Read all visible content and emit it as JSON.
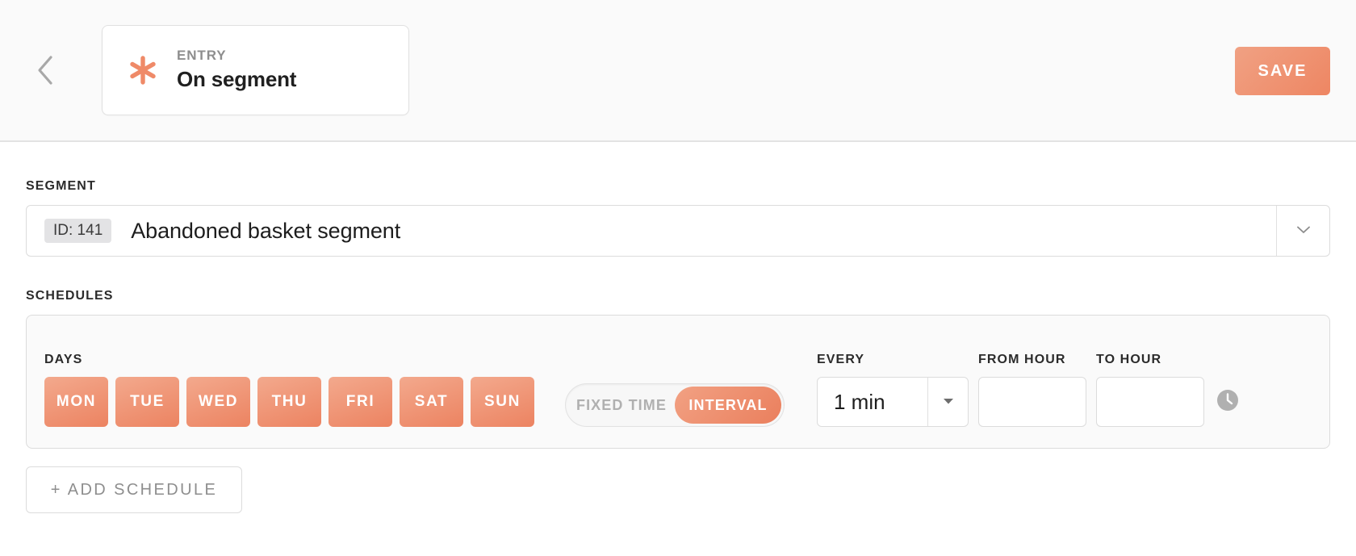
{
  "header": {
    "back_icon": "chevron-left-icon",
    "entry_kicker": "ENTRY",
    "entry_title": "On segment",
    "entry_icon": "asterisk-icon",
    "save_label": "SAVE",
    "accent_color": "#ee8663",
    "accent_light": "#f0a183"
  },
  "segment": {
    "label": "SEGMENT",
    "id_badge": "ID: 141",
    "name": "Abandoned basket segment",
    "caret_icon": "chevron-down-icon"
  },
  "schedules": {
    "label": "SCHEDULES",
    "days_label": "DAYS",
    "days": [
      {
        "label": "MON",
        "selected": true
      },
      {
        "label": "TUE",
        "selected": true
      },
      {
        "label": "WED",
        "selected": true
      },
      {
        "label": "THU",
        "selected": true
      },
      {
        "label": "FRI",
        "selected": true
      },
      {
        "label": "SAT",
        "selected": true
      },
      {
        "label": "SUN",
        "selected": true
      }
    ],
    "mode_toggle": {
      "fixed_time_label": "FIXED TIME",
      "interval_label": "INTERVAL",
      "active": "INTERVAL"
    },
    "every": {
      "label": "EVERY",
      "value": "1 min",
      "caret_icon": "chevron-down-icon"
    },
    "from_hour": {
      "label": "FROM HOUR",
      "value": "",
      "placeholder": ""
    },
    "to_hour": {
      "label": "TO HOUR",
      "value": "",
      "placeholder": ""
    },
    "clock_icon": "clock-icon",
    "add_schedule_label": "+ ADD SCHEDULE"
  }
}
